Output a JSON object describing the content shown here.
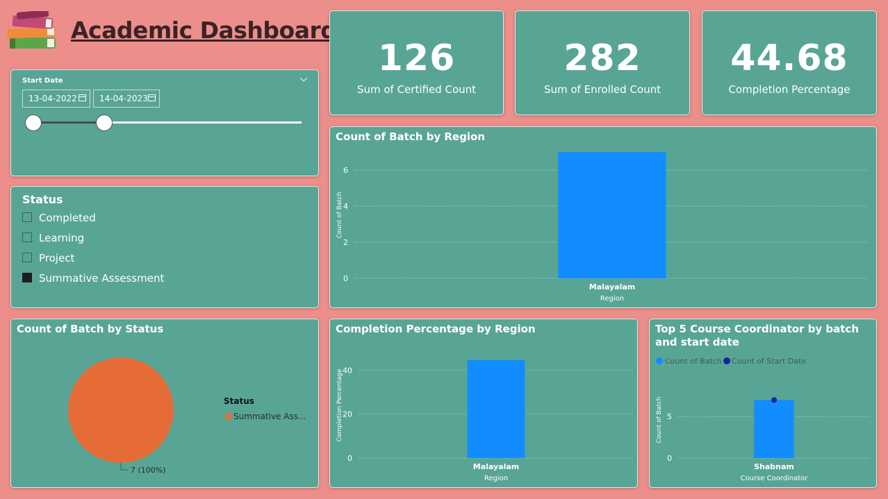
{
  "header": {
    "title": "Academic Dashboard",
    "logo_icon": "stacked-books-icon"
  },
  "kpis": [
    {
      "value": "126",
      "label": "Sum of Certified Count"
    },
    {
      "value": "282",
      "label": "Sum of Enrolled Count"
    },
    {
      "value": "44.68",
      "label": "Completion Percentage"
    }
  ],
  "date_slicer": {
    "title": "Start Date",
    "start": "13-04-2022",
    "end": "14-04-2023",
    "handle_start_fraction": 0,
    "handle_end_fraction": 0.26
  },
  "status_slicer": {
    "title": "Status",
    "items": [
      {
        "label": "Completed",
        "checked": false
      },
      {
        "label": "Learning",
        "checked": false
      },
      {
        "label": "Project",
        "checked": false
      },
      {
        "label": "Summative Assessment",
        "checked": true
      }
    ]
  },
  "colors": {
    "background": "#ec8f8b",
    "card": "#58a596",
    "bar": "#118dff",
    "dot": "#12239e",
    "pie": "#e66c37"
  },
  "chart_data": [
    {
      "type": "bar",
      "title": "Count of Batch by Region",
      "categories": [
        "Malayalam"
      ],
      "values": [
        7
      ],
      "xlabel": "Region",
      "ylabel": "Count of Batch",
      "yticks": [
        "0",
        "2",
        "4",
        "6"
      ],
      "ylim": [
        0,
        7
      ],
      "grid": true
    },
    {
      "type": "pie",
      "title": "Count of Batch by Status",
      "legend_title": "Status",
      "legend": [
        "Summative Ass..."
      ],
      "values": [
        7
      ],
      "data_label": "7 (100%)",
      "legend_position": "right"
    },
    {
      "type": "bar",
      "title": "Completion Percentage by Region",
      "categories": [
        "Malayalam"
      ],
      "values": [
        44.68
      ],
      "xlabel": "Region",
      "ylabel": "Completion Percentage",
      "yticks": [
        "0",
        "20",
        "40"
      ],
      "ylim": [
        0,
        48
      ],
      "grid": true
    },
    {
      "type": "bar",
      "title": "Top 5 Course Coordinator by batch and start date",
      "categories": [
        "Shabnam"
      ],
      "series": [
        {
          "name": "Count of Batch",
          "values": [
            7
          ]
        },
        {
          "name": "Count of Start Date",
          "values": [
            7
          ]
        }
      ],
      "xlabel": "Course Coordinator",
      "ylabel": "Count of Batch",
      "yticks": [
        "0",
        "5"
      ],
      "ylim": [
        0,
        9.2
      ],
      "legend_position": "top-left",
      "grid": true
    }
  ]
}
